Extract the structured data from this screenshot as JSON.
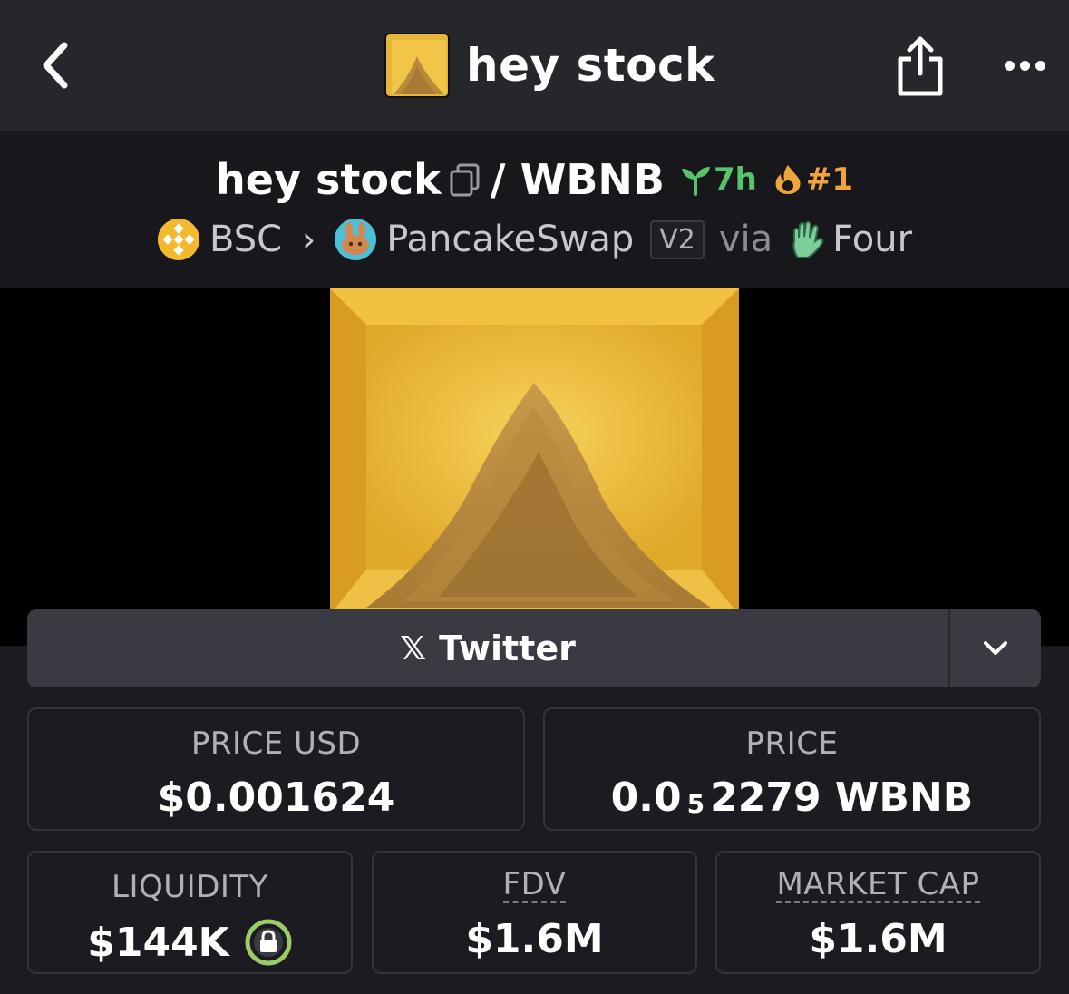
{
  "nav": {
    "title": "hey stock"
  },
  "pair": {
    "base": "hey stock",
    "separator": "/",
    "quote": "WBNB",
    "age": "7h",
    "rank": "#1"
  },
  "meta": {
    "chain": "BSC",
    "dex": "PancakeSwap",
    "version": "V2",
    "via": "via",
    "launchpad": "Four"
  },
  "social": {
    "label": "Twitter"
  },
  "stats": {
    "price_usd_label": "PRICE USD",
    "price_usd_value": "$0.001624",
    "price_label": "PRICE",
    "price_value_prefix": "0.0",
    "price_value_zeros": "5",
    "price_value_suffix": "2279 WBNB",
    "liquidity_label": "LIQUIDITY",
    "liquidity_value": "$144K",
    "fdv_label": "FDV",
    "fdv_value": "$1.6M",
    "mcap_label": "MARKET CAP",
    "mcap_value": "$1.6M"
  },
  "colors": {
    "age_green": "#59c36a",
    "rank_orange": "#f0a53a",
    "lock_green": "#9ccc65",
    "bnb_yellow": "#f3ba2f"
  },
  "icons": [
    "back-chevron-icon",
    "share-icon",
    "more-icon",
    "copy-icon",
    "sprout-icon",
    "flame-icon",
    "bnb-chain-icon",
    "pancakeswap-icon",
    "four-hand-icon",
    "x-logo-icon",
    "chevron-down-icon",
    "lock-icon"
  ]
}
